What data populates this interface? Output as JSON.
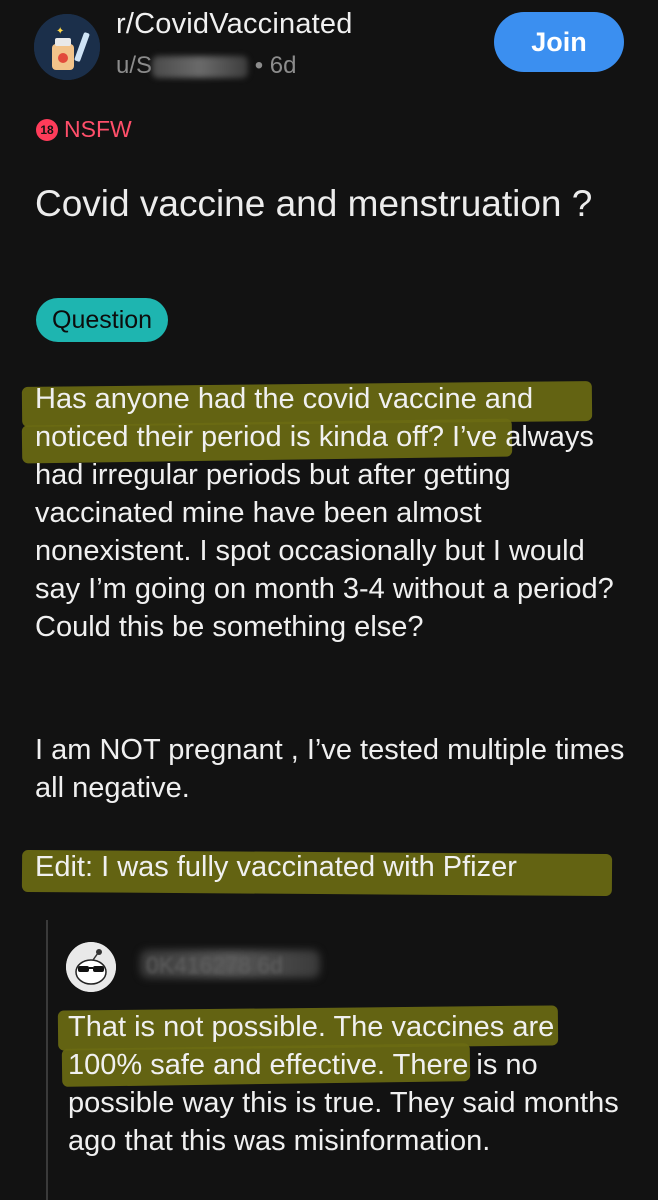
{
  "header": {
    "subreddit": "r/CovidVaccinated",
    "user_prefix": "u/S",
    "time": "• 6d",
    "join_label": "Join"
  },
  "post": {
    "nsfw_badge": "18",
    "nsfw_label": "NSFW",
    "title": "Covid vaccine and menstruation ?",
    "flair": "Question",
    "paragraphs": [
      "Has anyone had the covid vaccine and noticed their period is kinda off? I’ve always had irregular periods but after getting vaccinated mine have been almost nonexistent. I spot occasionally but I would say I’m going on month 3-4 without a period? Could this be something else?",
      "I am NOT pregnant , I’ve tested multiple times all negative.",
      "Edit: I was fully vaccinated with Pfizer"
    ]
  },
  "comment": {
    "author_obscured": "0K416278 6d",
    "text": "That is not possible. The vaccines are 100% safe and effective. There is no possible way this is true. They said months ago that this was misinformation."
  },
  "colors": {
    "background": "#121212",
    "join_button": "#3b8ff0",
    "nsfw": "#ff4f6a",
    "flair": "#1eb5b0",
    "highlight": "#6a6a12"
  }
}
